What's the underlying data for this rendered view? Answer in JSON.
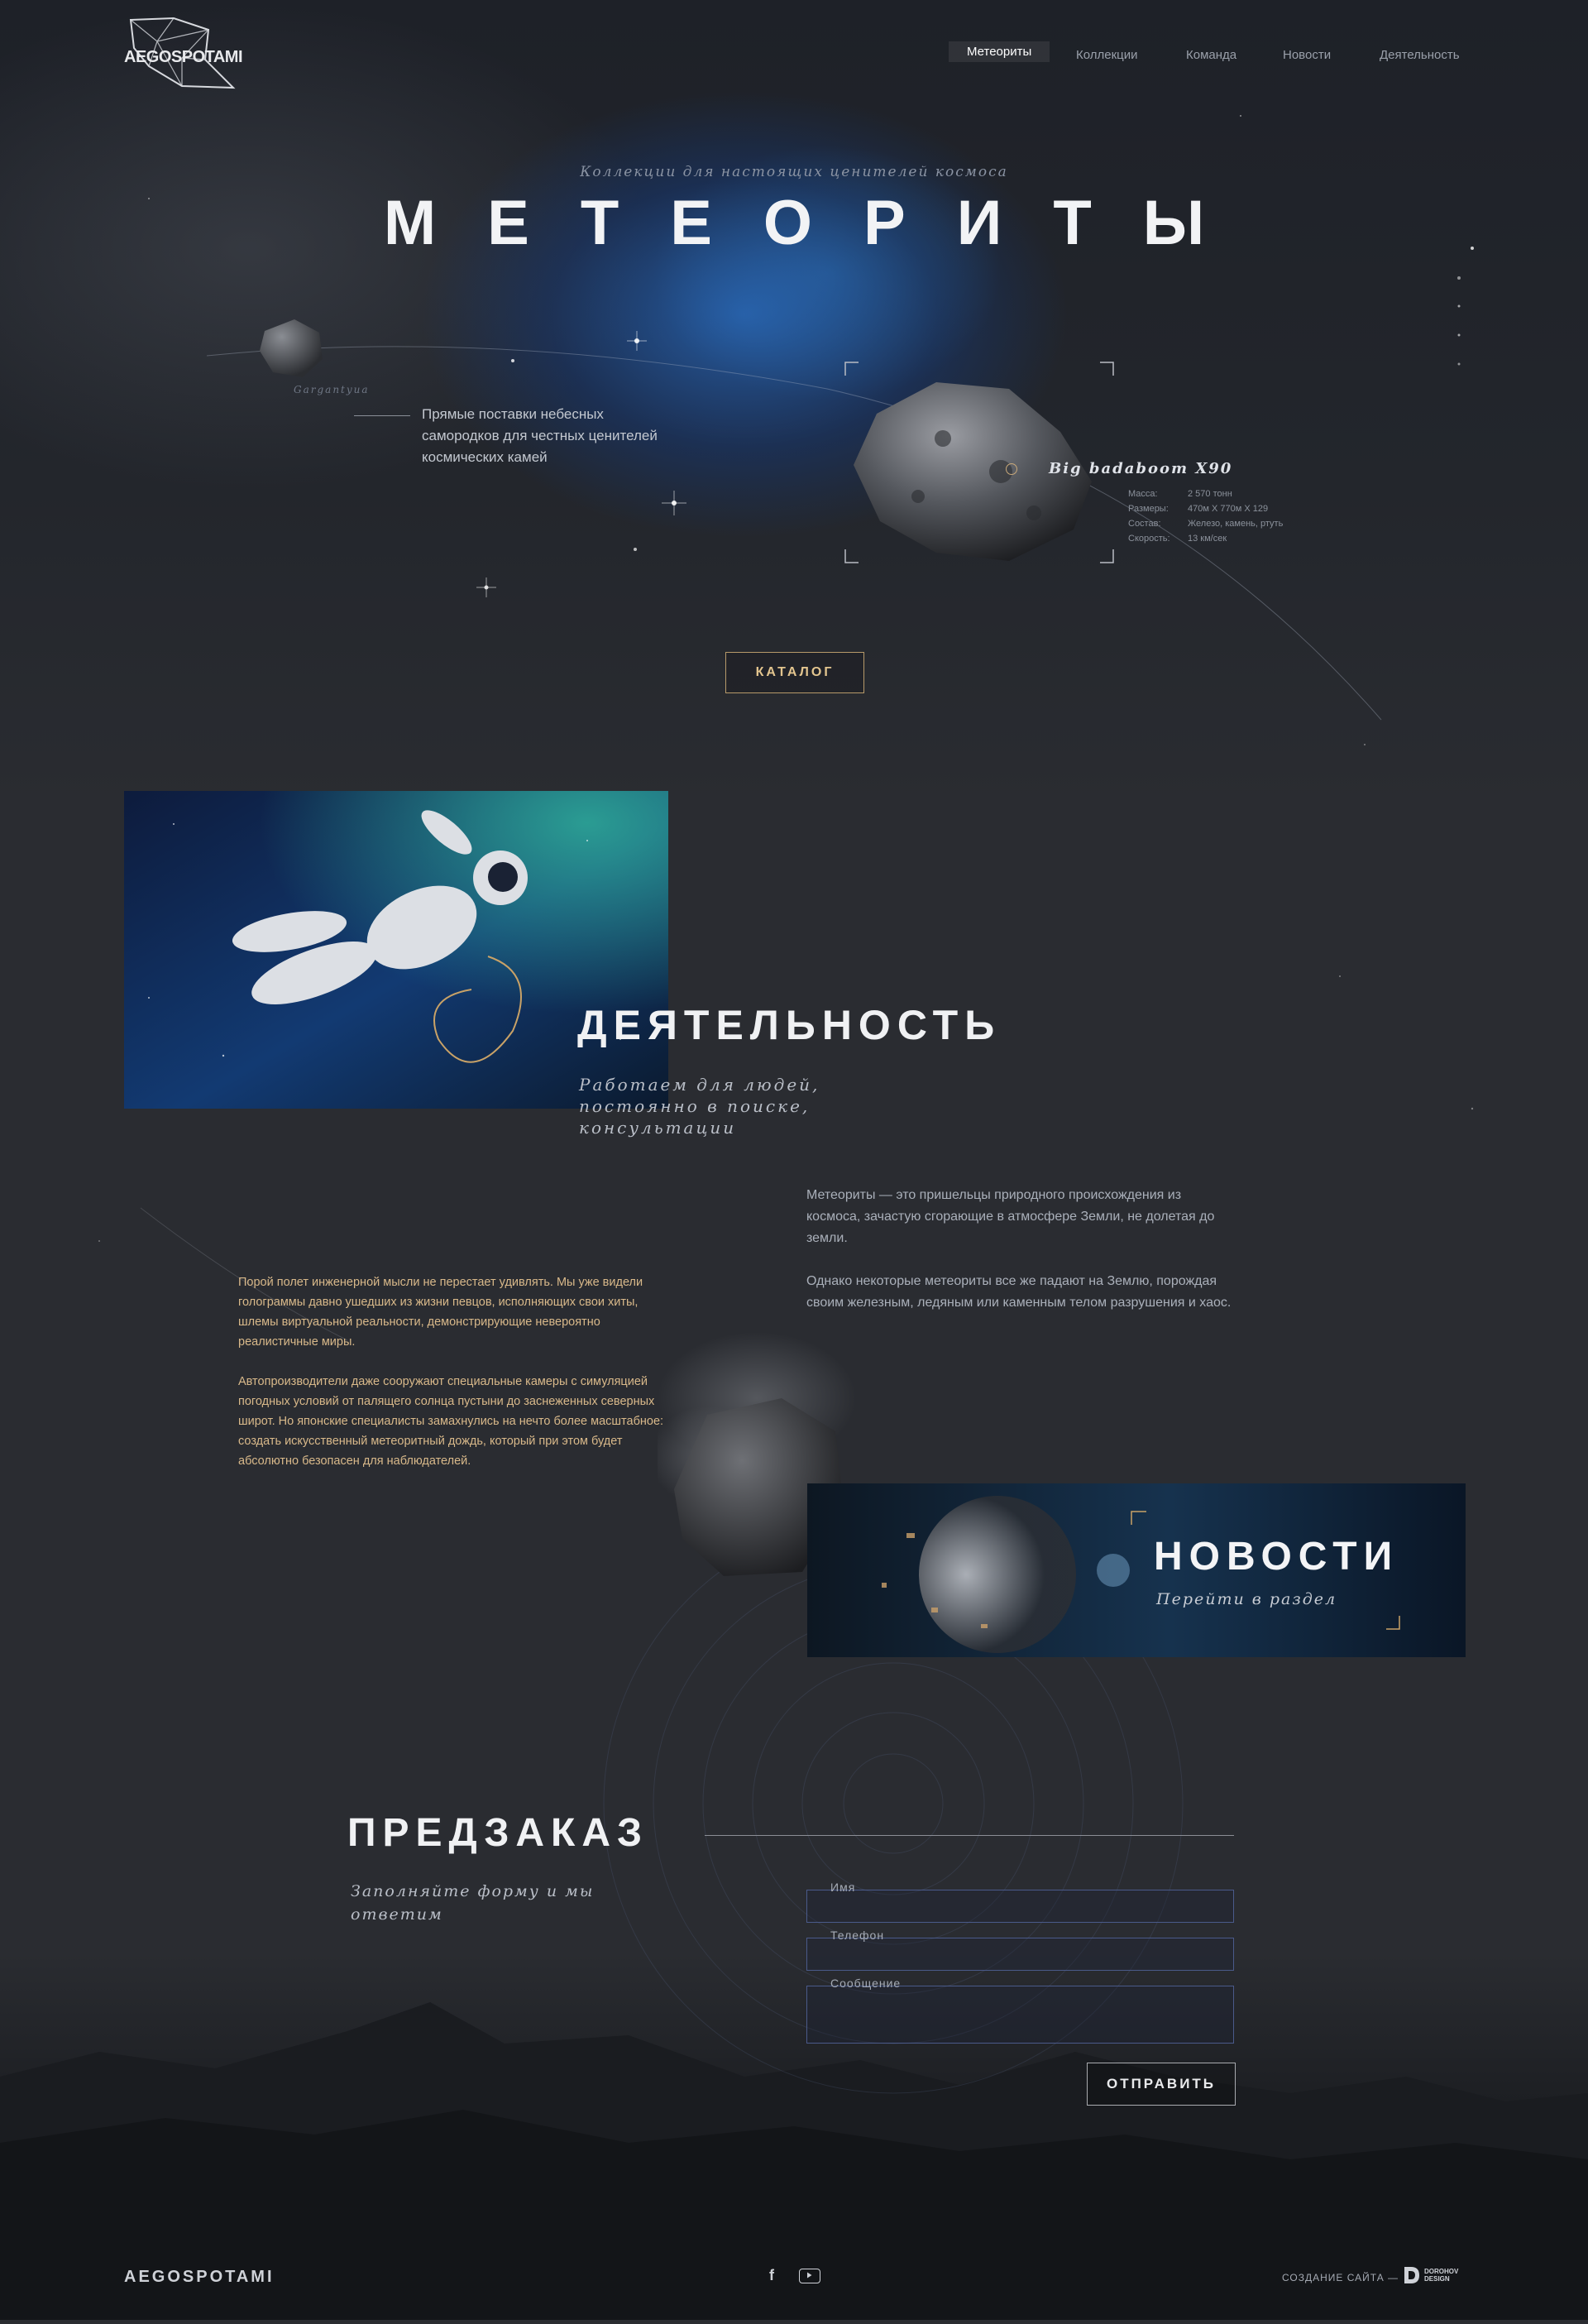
{
  "header": {
    "logo_text": "AEGOSPOTAMI",
    "nav": [
      {
        "label": "Метеориты",
        "active": true
      },
      {
        "label": "Коллекции",
        "active": false
      },
      {
        "label": "Команда",
        "active": false
      },
      {
        "label": "Новости",
        "active": false
      },
      {
        "label": "Деятельность",
        "active": false
      }
    ]
  },
  "hero": {
    "subtitle": "Коллекции для настоящих ценителей космоса",
    "title": "МЕТЕОРИТЫ",
    "small_rock_label": "Gargantyua",
    "tagline": "Прямые поставки небесных самородков для честных ценителей космических камей",
    "featured_rock": {
      "name": "Big badaboom X90",
      "specs": [
        {
          "key": "Масса:",
          "value": "2 570 тонн"
        },
        {
          "key": "Размеры:",
          "value": "470м X 770м X 129"
        },
        {
          "key": "Состав:",
          "value": "Железо, камень, ртуть"
        },
        {
          "key": "Скорость:",
          "value": "13 км/сек"
        }
      ]
    },
    "catalog_button": "КАТАЛОГ"
  },
  "activity": {
    "title": "ДЕЯТЕЛЬНОСТЬ",
    "subtitle": "Работаем для людей, постоянно в поиске, консультации",
    "right_p1": "Метеориты — это пришельцы природного происхождения из космоса, зачастую сгорающие в атмосфере Земли, не долетая до земли.",
    "right_p2": "Однако некоторые метеориты все же падают на Землю, порождая своим железным, ледяным или каменным телом разрушения и хаос.",
    "left_p1": "Порой полет инженерной мысли не перестает удивлять. Мы уже видели голограммы давно ушедших из жизни певцов, исполняющих свои хиты, шлемы виртуальной реальности, демонстрирующие невероятно реалистичные миры.",
    "left_p2": "Автопроизводители даже сооружают специальные камеры с симуляцией погодных условий от палящего солнца пустыни до заснеженных северных широт. Но японские специалисты замахнулись на нечто более масштабное: создать искусственный метеоритный дождь, который при этом будет абсолютно безопасен для наблюдателей."
  },
  "news": {
    "title": "НОВОСТИ",
    "subtitle": "Перейти в раздел"
  },
  "preorder": {
    "title": "ПРЕДЗАКАЗ",
    "subtitle": "Заполняйте форму и мы ответим",
    "fields": {
      "name": "Имя",
      "phone": "Телефон",
      "message": "Сообщение"
    },
    "submit": "ОТПРАВИТЬ"
  },
  "footer": {
    "brand": "AEGOSPOTAMI",
    "facebook_icon": "f",
    "youtube_icon": "youtube-icon",
    "credit": "СОЗДАНИЕ САЙТА —",
    "credit_logo_line1": "DOROHOV",
    "credit_logo_line2": "DESIGN"
  },
  "colors": {
    "background": "#2a2c31",
    "accent_gold": "#d9b98a",
    "nebula_blue": "#2a6ec8",
    "field_border": "#4a5a8a"
  }
}
